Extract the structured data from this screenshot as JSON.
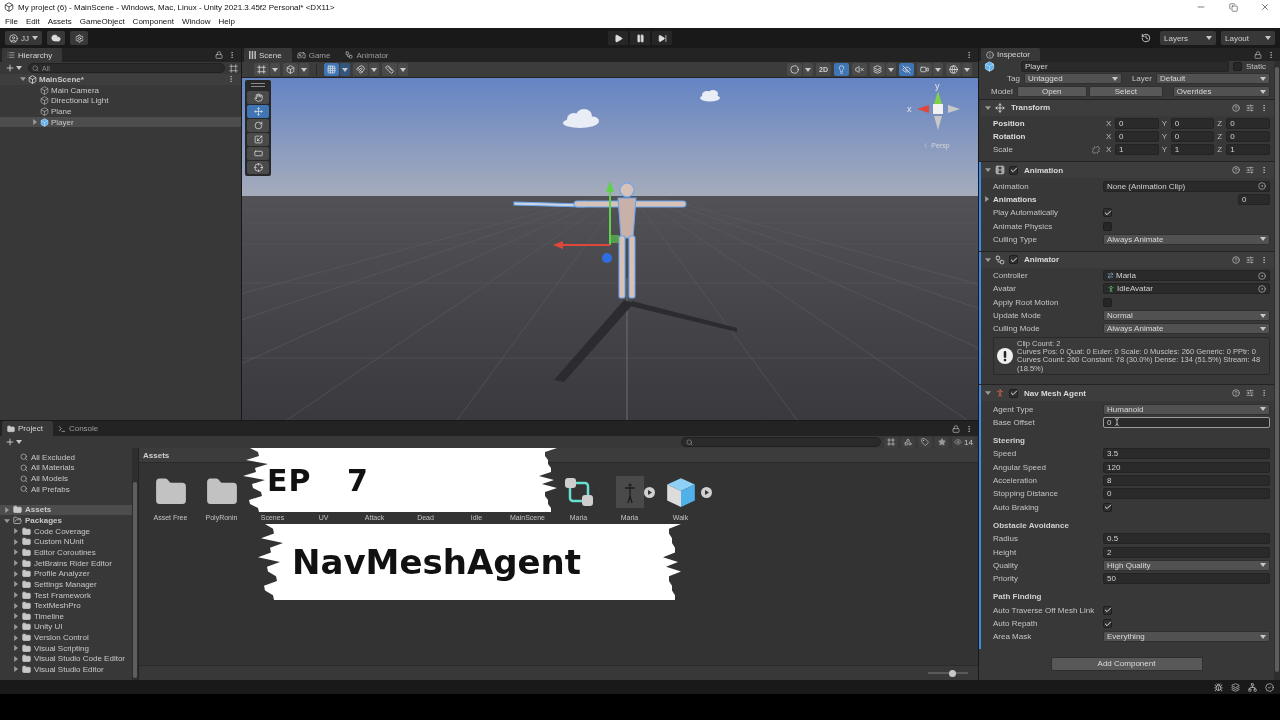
{
  "window": {
    "title": "My project (6) - MainScene - Windows, Mac, Linux - Unity 2021.3.45f2 Personal* <DX11>"
  },
  "menu": [
    "File",
    "Edit",
    "Assets",
    "GameObject",
    "Component",
    "Window",
    "Help"
  ],
  "toolbar": {
    "account": "JJ",
    "layers": "Layers",
    "layout": "Layout"
  },
  "hierarchy": {
    "tab": {
      "label": "Hierarchy",
      "selected": true
    },
    "search": {
      "placeholder": "All"
    },
    "scene": {
      "name": "MainScene*",
      "expanded": true,
      "selected": false,
      "children": [
        {
          "name": "Main Camera",
          "kind": "object",
          "selected": false
        },
        {
          "name": "Directional Light",
          "kind": "object",
          "selected": false
        },
        {
          "name": "Plane",
          "kind": "object",
          "selected": false
        },
        {
          "name": "Player",
          "kind": "prefab",
          "selected": true,
          "expanded": false
        }
      ]
    }
  },
  "scene_view": {
    "tabs": [
      {
        "label": "Scene",
        "selected": true
      },
      {
        "label": "Game",
        "selected": false
      },
      {
        "label": "Animator",
        "selected": false
      }
    ],
    "toolbar_left": [
      {
        "kind": "handle",
        "on": false
      },
      {
        "kind": "pivot",
        "on": false
      },
      {
        "kind": "grid",
        "on": true
      },
      {
        "kind": "snap",
        "on": false
      },
      {
        "kind": "increment",
        "on": false
      }
    ],
    "toolbar_right": [
      {
        "kind": "shading",
        "on": false
      },
      {
        "kind": "dimension",
        "label": "2D",
        "on": false
      },
      {
        "kind": "lighting",
        "on": true
      },
      {
        "kind": "audio",
        "on": false
      },
      {
        "kind": "effects",
        "on": false
      },
      {
        "kind": "visibility",
        "on": true
      },
      {
        "kind": "camera",
        "on": false
      },
      {
        "kind": "gizmos",
        "on": false
      }
    ],
    "tools": [
      {
        "kind": "hand",
        "selected": false
      },
      {
        "kind": "move",
        "selected": true
      },
      {
        "kind": "rotate",
        "selected": false
      },
      {
        "kind": "scale",
        "selected": false
      },
      {
        "kind": "rect",
        "selected": false
      },
      {
        "kind": "transform",
        "selected": false
      }
    ],
    "gizmo_axes": [
      "y",
      "x"
    ],
    "projection": "Persp"
  },
  "project": {
    "tabs": [
      {
        "label": "Project",
        "selected": true
      },
      {
        "label": "Console",
        "selected": false
      }
    ],
    "favorites": [
      {
        "name": "All Excluded",
        "selected": false
      },
      {
        "name": "All Materials",
        "selected": false
      },
      {
        "name": "All Models",
        "selected": false
      },
      {
        "name": "All Prefabs",
        "selected": false
      }
    ],
    "roots": [
      {
        "name": "Assets",
        "expanded": false,
        "selected": true
      },
      {
        "name": "Packages",
        "expanded": true,
        "selected": false,
        "children": [
          {
            "name": "Code Coverage",
            "expanded": false,
            "selected": false
          },
          {
            "name": "Custom NUnit",
            "expanded": false,
            "selected": false
          },
          {
            "name": "Editor Coroutines",
            "expanded": false,
            "selected": false
          },
          {
            "name": "JetBrains Rider Editor",
            "expanded": false,
            "selected": false
          },
          {
            "name": "Profile Analyzer",
            "expanded": false,
            "selected": false
          },
          {
            "name": "Settings Manager",
            "expanded": false,
            "selected": false
          },
          {
            "name": "Test Framework",
            "expanded": false,
            "selected": false
          },
          {
            "name": "TextMeshPro",
            "expanded": false,
            "selected": false
          },
          {
            "name": "Timeline",
            "expanded": false,
            "selected": false
          },
          {
            "name": "Unity UI",
            "expanded": false,
            "selected": false
          },
          {
            "name": "Version Control",
            "expanded": false,
            "selected": false
          },
          {
            "name": "Visual Scripting",
            "expanded": false,
            "selected": false
          },
          {
            "name": "Visual Studio Code Editor",
            "expanded": false,
            "selected": false
          },
          {
            "name": "Visual Studio Editor",
            "expanded": false,
            "selected": false
          }
        ]
      }
    ],
    "hidden_count": "14",
    "breadcrumb": "Assets",
    "assets": [
      {
        "name": "Asset Free",
        "kind": "folder",
        "selected": false
      },
      {
        "name": "PolyRonin",
        "kind": "folder",
        "selected": false
      },
      {
        "name": "Scenes",
        "selected": false
      },
      {
        "name": "UV",
        "selected": false
      },
      {
        "name": "Attack",
        "selected": false
      },
      {
        "name": "Dead",
        "selected": false
      },
      {
        "name": "Idle",
        "selected": false
      },
      {
        "name": "MainScene",
        "selected": false
      },
      {
        "name": "Maria",
        "kind": "controller",
        "selected": false
      },
      {
        "name": "Maria",
        "kind": "model",
        "selected": false
      },
      {
        "name": "Walk",
        "kind": "prefab",
        "selected": false
      }
    ],
    "icon_size": {
      "level": 0.6
    }
  },
  "overlay": {
    "episode": "EP 7",
    "title": "NavMeshAgent"
  },
  "inspector": {
    "tab": {
      "label": "Inspector",
      "selected": true
    },
    "object": {
      "name": "Player",
      "static_label": "Static",
      "static": false
    },
    "tag_label": "Tag",
    "tag": "Untagged",
    "layer_label": "Layer",
    "layer": "Default",
    "model_label": "Model",
    "model_buttons": [
      "Open",
      "Select"
    ],
    "overrides": "Overrides",
    "components": [
      {
        "name": "Transform",
        "kind": "transform",
        "expanded": true,
        "rows": [
          {
            "kind": "vector",
            "label": "Position",
            "overridden": true,
            "values": [
              {
                "axis": "X",
                "value": "0"
              },
              {
                "axis": "Y",
                "value": "0"
              },
              {
                "axis": "Z",
                "value": "0"
              }
            ]
          },
          {
            "kind": "vector",
            "label": "Rotation",
            "overridden": true,
            "values": [
              {
                "axis": "X",
                "value": "0"
              },
              {
                "axis": "Y",
                "value": "0"
              },
              {
                "axis": "Z",
                "value": "0"
              }
            ]
          },
          {
            "kind": "vector",
            "label": "Scale",
            "overridden": false,
            "constrained": false,
            "values": [
              {
                "axis": "X",
                "value": "1"
              },
              {
                "axis": "Y",
                "value": "1"
              },
              {
                "axis": "Z",
                "value": "1"
              }
            ]
          }
        ]
      },
      {
        "name": "Animation",
        "kind": "animation",
        "expanded": true,
        "enabled": true,
        "added": true,
        "rows": [
          {
            "kind": "object",
            "label": "Animation",
            "value": "None (Animation Clip)"
          },
          {
            "kind": "foldout",
            "label": "Animations",
            "value": "0",
            "expanded": false
          },
          {
            "kind": "checkbox",
            "label": "Play Automatically",
            "checked": true
          },
          {
            "kind": "checkbox",
            "label": "Animate Physics",
            "checked": false
          },
          {
            "kind": "dropdown",
            "label": "Culling Type",
            "value": "Always Animate"
          }
        ]
      },
      {
        "name": "Animator",
        "kind": "animator",
        "expanded": true,
        "enabled": true,
        "added": true,
        "rows": [
          {
            "kind": "controller",
            "label": "Controller",
            "value": "Maria"
          },
          {
            "kind": "avatar",
            "label": "Avatar",
            "value": "IdleAvatar"
          },
          {
            "kind": "checkbox",
            "label": "Apply Root Motion",
            "checked": false
          },
          {
            "kind": "dropdown",
            "label": "Update Mode",
            "value": "Normal"
          },
          {
            "kind": "dropdown",
            "label": "Culling Mode",
            "value": "Always Animate"
          },
          {
            "kind": "info",
            "lines": [
              "Clip Count: 2",
              "Curves Pos: 0 Quat: 0 Euler: 0 Scale: 0 Muscles: 260 Generic: 0 PPtr: 0",
              "Curves Count: 260 Constant: 78 (30.0%) Dense: 134 (51.5%) Stream: 48 (18.5%)"
            ]
          }
        ]
      },
      {
        "name": "Nav Mesh Agent",
        "kind": "navmesh",
        "expanded": true,
        "enabled": true,
        "added": true,
        "rows": [
          {
            "kind": "dropdown",
            "label": "Agent Type",
            "value": "Humanoid"
          },
          {
            "kind": "number",
            "label": "Base Offset",
            "value": "0",
            "focused": true
          },
          {
            "kind": "header",
            "label": "Steering"
          },
          {
            "kind": "number",
            "label": "Speed",
            "value": "3.5",
            "focused": false
          },
          {
            "kind": "number",
            "label": "Angular Speed",
            "value": "120",
            "focused": false
          },
          {
            "kind": "number",
            "label": "Acceleration",
            "value": "8",
            "focused": false
          },
          {
            "kind": "number",
            "label": "Stopping Distance",
            "value": "0",
            "focused": false
          },
          {
            "kind": "checkbox",
            "label": "Auto Braking",
            "checked": true
          },
          {
            "kind": "header",
            "label": "Obstacle Avoidance"
          },
          {
            "kind": "number",
            "label": "Radius",
            "value": "0.5",
            "focused": false
          },
          {
            "kind": "number",
            "label": "Height",
            "value": "2",
            "focused": false
          },
          {
            "kind": "dropdown",
            "label": "Quality",
            "value": "High Quality"
          },
          {
            "kind": "number",
            "label": "Priority",
            "value": "50",
            "focused": false
          },
          {
            "kind": "header",
            "label": "Path Finding"
          },
          {
            "kind": "checkbox",
            "label": "Auto Traverse Off Mesh Link",
            "checked": true
          },
          {
            "kind": "checkbox",
            "label": "Auto Repath",
            "checked": true
          },
          {
            "kind": "dropdown",
            "label": "Area Mask",
            "value": "Everything"
          }
        ]
      }
    ],
    "add_component": "Add Component"
  }
}
